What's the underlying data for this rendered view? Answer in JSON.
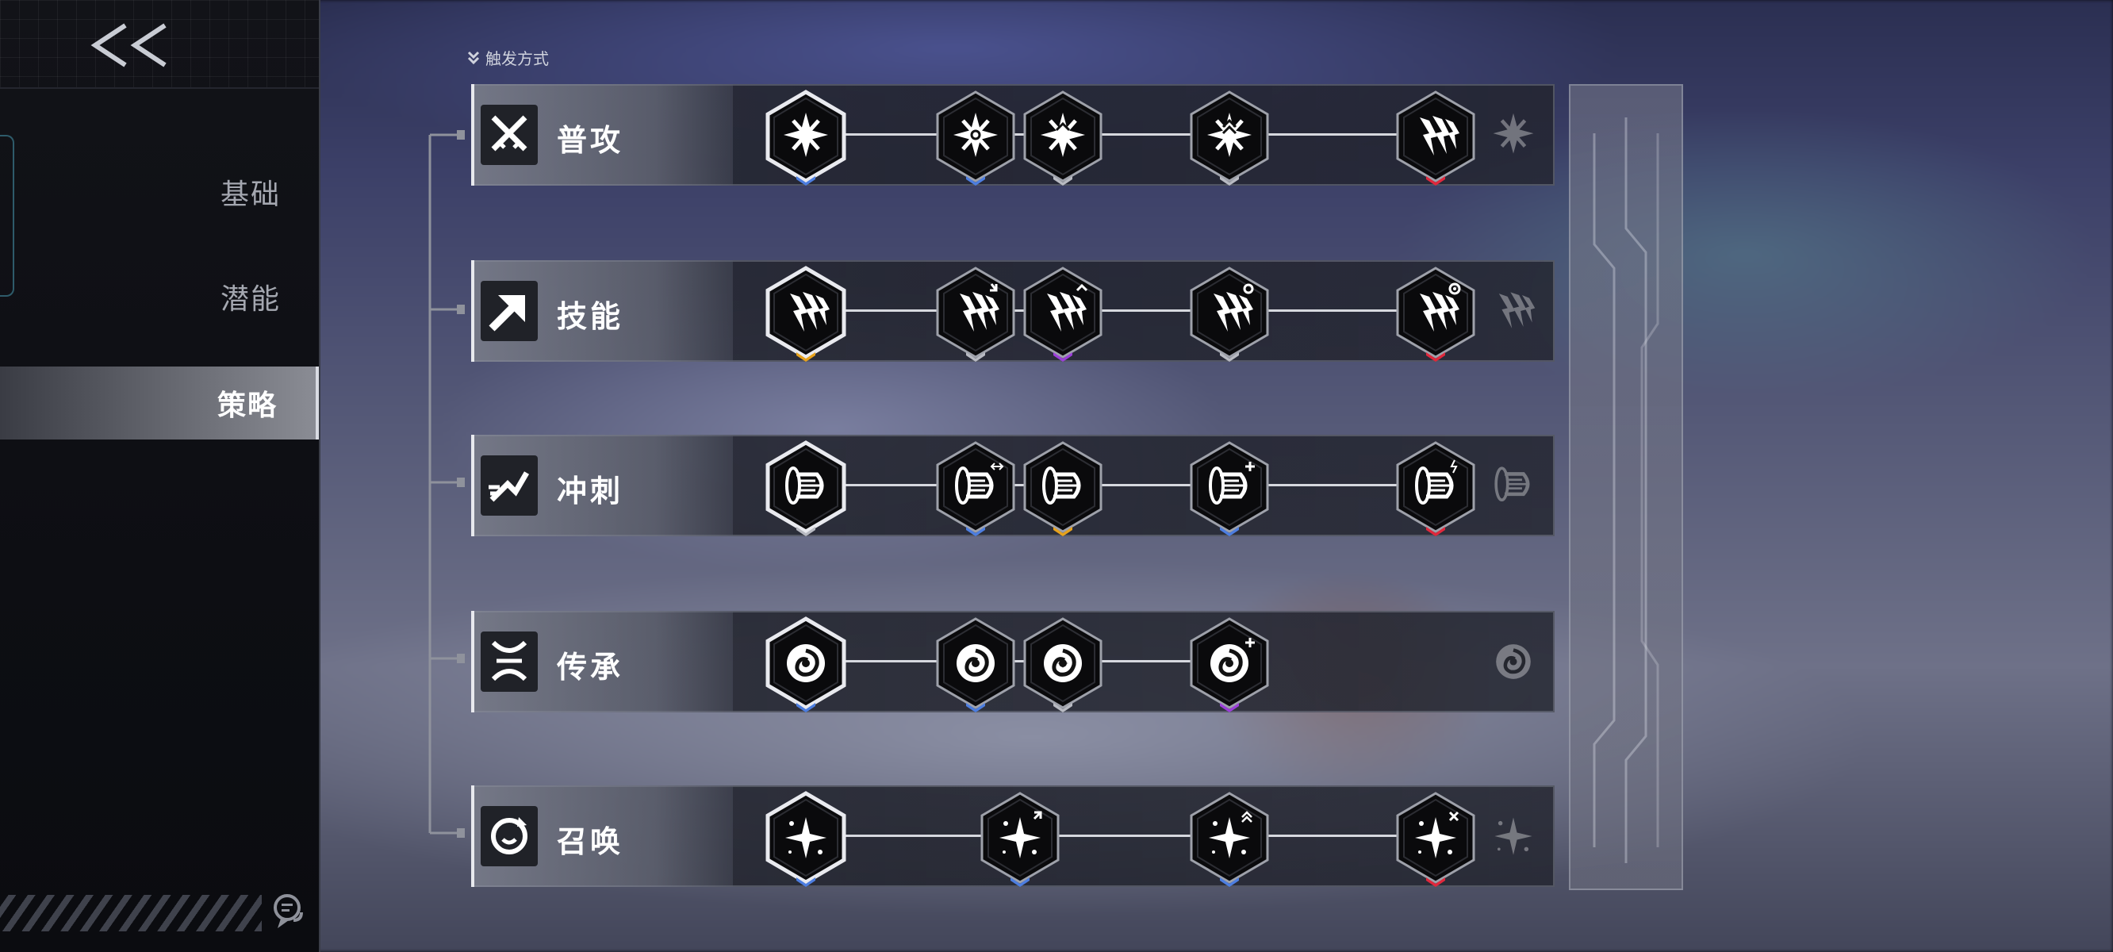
{
  "navigation": {
    "back_label": "<<",
    "items": [
      {
        "label": "基础",
        "active": false
      },
      {
        "label": "潜能",
        "active": false
      },
      {
        "label": "策略",
        "active": true
      }
    ]
  },
  "header": {
    "trigger_label": "触发方式"
  },
  "rows": [
    {
      "name": "普攻",
      "icon": "crossed-swords-icon",
      "nodes": [
        {
          "icon": "shuriken-icon",
          "badge": "blue",
          "selected": true
        },
        {
          "icon": "shuriken-c-icon",
          "badge": "blue"
        },
        {
          "icon": "shuriken-up-icon",
          "badge": "gray"
        },
        {
          "icon": "shuriken-double-up-icon",
          "badge": "gray"
        },
        {
          "icon": "lightning-claw-icon",
          "badge": "red"
        }
      ]
    },
    {
      "name": "技能",
      "icon": "arrow-up-right-icon",
      "nodes": [
        {
          "icon": "lightning-claw-icon",
          "badge": "gold",
          "selected": true
        },
        {
          "icon": "lightning-claw-arrow-icon",
          "badge": "gray"
        },
        {
          "icon": "lightning-claw-caret-icon",
          "badge": "purple"
        },
        {
          "icon": "lightning-claw-swirl-icon",
          "badge": "gray"
        },
        {
          "icon": "lightning-claw-gear-icon",
          "badge": "red"
        }
      ]
    },
    {
      "name": "冲刺",
      "icon": "dash-runner-icon",
      "nodes": [
        {
          "icon": "dash-portal-icon",
          "badge": "gray",
          "selected": true
        },
        {
          "icon": "dash-portal-arrows-icon",
          "badge": "blue"
        },
        {
          "icon": "dash-portal-icon",
          "badge": "gold"
        },
        {
          "icon": "dash-portal-plus-icon",
          "badge": "blue"
        },
        {
          "icon": "dash-portal-bolt-icon",
          "badge": "red"
        }
      ]
    },
    {
      "name": "传承",
      "icon": "dna-helix-icon",
      "nodes": [
        {
          "icon": "vortex-icon",
          "badge": "blue",
          "selected": true
        },
        {
          "icon": "vortex-icon",
          "badge": "blue"
        },
        {
          "icon": "vortex-star-icon",
          "badge": "gray"
        },
        {
          "icon": "vortex-plus-icon",
          "badge": "purple"
        }
      ]
    },
    {
      "name": "召唤",
      "icon": "summon-circle-icon",
      "nodes": [
        {
          "icon": "sparkle-icon",
          "badge": "blue",
          "selected": true
        },
        {
          "icon": "sparkle-arrow-icon",
          "badge": "blue"
        },
        {
          "icon": "sparkle-chevron-icon",
          "badge": "blue"
        },
        {
          "icon": "sparkle-cross-icon",
          "badge": "red"
        }
      ]
    }
  ],
  "colors": {
    "blue": "#4d7ee0",
    "gold": "#e7a21d",
    "purple": "#9b3fd8",
    "red": "#e0283c",
    "gray": "#b8bac2"
  }
}
